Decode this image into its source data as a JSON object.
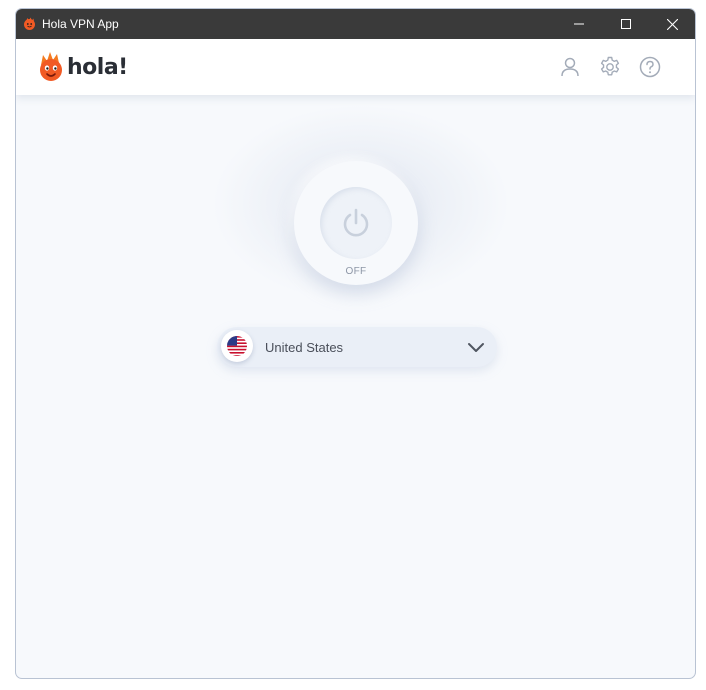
{
  "window": {
    "title": "Hola VPN App",
    "controls": {
      "minimize": "minimize",
      "maximize": "maximize",
      "close": "close"
    }
  },
  "header": {
    "logo_text": "hola!",
    "icons": [
      "user-icon",
      "gear-icon",
      "help-icon"
    ]
  },
  "power": {
    "status_label": "OFF"
  },
  "location": {
    "country": "United States",
    "flag": "us-flag-icon"
  },
  "colors": {
    "titlebar": "#3a3a3a",
    "accent_flame": "#f47a1f",
    "background": "#f7f9fc"
  }
}
